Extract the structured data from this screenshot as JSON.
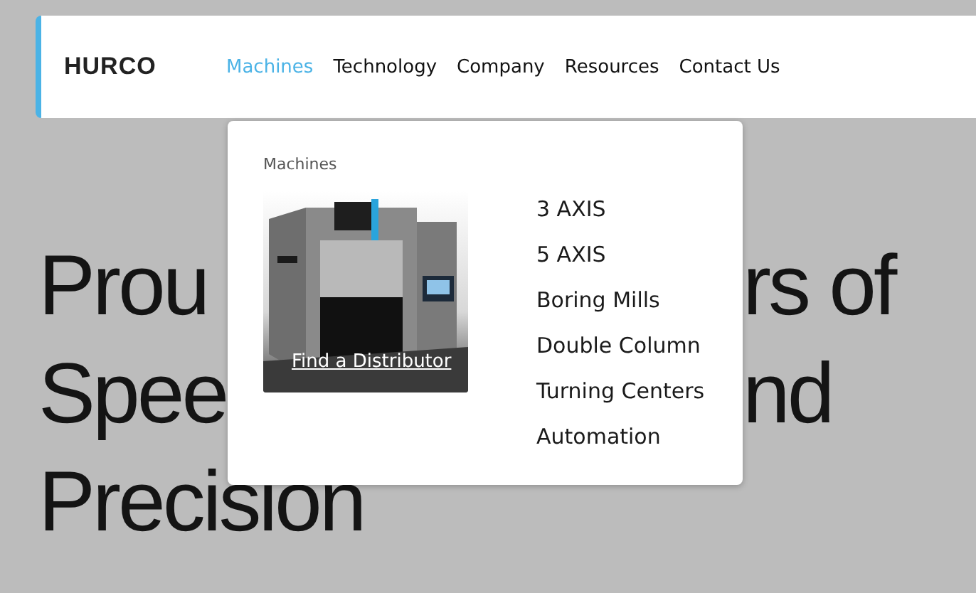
{
  "header": {
    "logo": "HURCO",
    "nav": [
      {
        "label": "Machines",
        "selected": true
      },
      {
        "label": "Technology",
        "selected": false
      },
      {
        "label": "Company",
        "selected": false
      },
      {
        "label": "Resources",
        "selected": false
      },
      {
        "label": "Contact Us",
        "selected": false
      }
    ]
  },
  "dropdown": {
    "heading": "Machines",
    "picture": {
      "link": "Find a Distributor"
    },
    "items": [
      "3 AXIS",
      "5 AXIS",
      "Boring Mills",
      "Double Column",
      "Turning Centers",
      "Automation"
    ]
  },
  "hero": {
    "lines": [
      [
        "Prou",
        "rs of"
      ],
      [
        "Spee",
        "nd"
      ],
      [
        "Precision"
      ]
    ]
  }
}
